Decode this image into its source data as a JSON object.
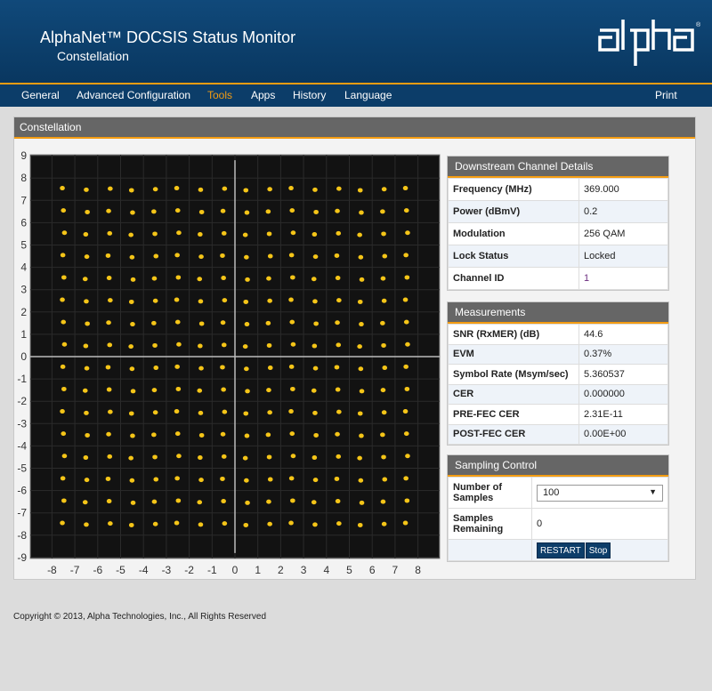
{
  "header": {
    "title": "AlphaNet™ DOCSIS Status Monitor",
    "subtitle": "Constellation",
    "logo_text": "alpha"
  },
  "nav": {
    "items": [
      "General",
      "Advanced Configuration",
      "Tools",
      "Apps",
      "History",
      "Language"
    ],
    "active": "Tools",
    "print_label": "Print"
  },
  "panel": {
    "title": "Constellation"
  },
  "plot": {
    "background": "#121212",
    "point_color": "#f5c518",
    "x_ticks": [
      "-8",
      "-7",
      "-6",
      "-5",
      "-4",
      "-3",
      "-2",
      "-1",
      "0",
      "1",
      "2",
      "3",
      "4",
      "5",
      "6",
      "7",
      "8"
    ],
    "y_ticks": [
      "9",
      "8",
      "7",
      "6",
      "5",
      "4",
      "3",
      "2",
      "1",
      "0",
      "-1",
      "-2",
      "-3",
      "-4",
      "-5",
      "-6",
      "-7",
      "-8",
      "-9"
    ],
    "point_levels": [
      -7.5,
      -6.5,
      -5.5,
      -4.5,
      -3.5,
      -2.5,
      -1.5,
      -0.5,
      0.5,
      1.5,
      2.5,
      3.5,
      4.5,
      5.5,
      6.5,
      7.5
    ]
  },
  "downstream": {
    "title": "Downstream Channel Details",
    "rows": [
      {
        "label": "Frequency (MHz)",
        "value": "369.000"
      },
      {
        "label": "Power (dBmV)",
        "value": "0.2"
      },
      {
        "label": "Modulation",
        "value": "256 QAM"
      },
      {
        "label": "Lock Status",
        "value": "Locked"
      },
      {
        "label": "Channel ID",
        "value": "1"
      }
    ]
  },
  "measurements": {
    "title": "Measurements",
    "rows": [
      {
        "label": "SNR (RxMER) (dB)",
        "value": "44.6"
      },
      {
        "label": "EVM",
        "value": "0.37%"
      },
      {
        "label": "Symbol Rate (Msym/sec)",
        "value": "5.360537"
      },
      {
        "label": "CER",
        "value": "0.000000"
      },
      {
        "label": "PRE-FEC CER",
        "value": "2.31E-11"
      },
      {
        "label": "POST-FEC CER",
        "value": "0.00E+00"
      }
    ]
  },
  "sampling": {
    "title": "Sampling Control",
    "samples_label": "Number of Samples",
    "samples_value": "100",
    "remaining_label": "Samples Remaining",
    "remaining_value": "0",
    "restart_label": "RESTART",
    "stop_label": "Stop"
  },
  "footer": {
    "copyright": "Copyright © 2013, Alpha Technologies, Inc., All Rights Reserved"
  }
}
